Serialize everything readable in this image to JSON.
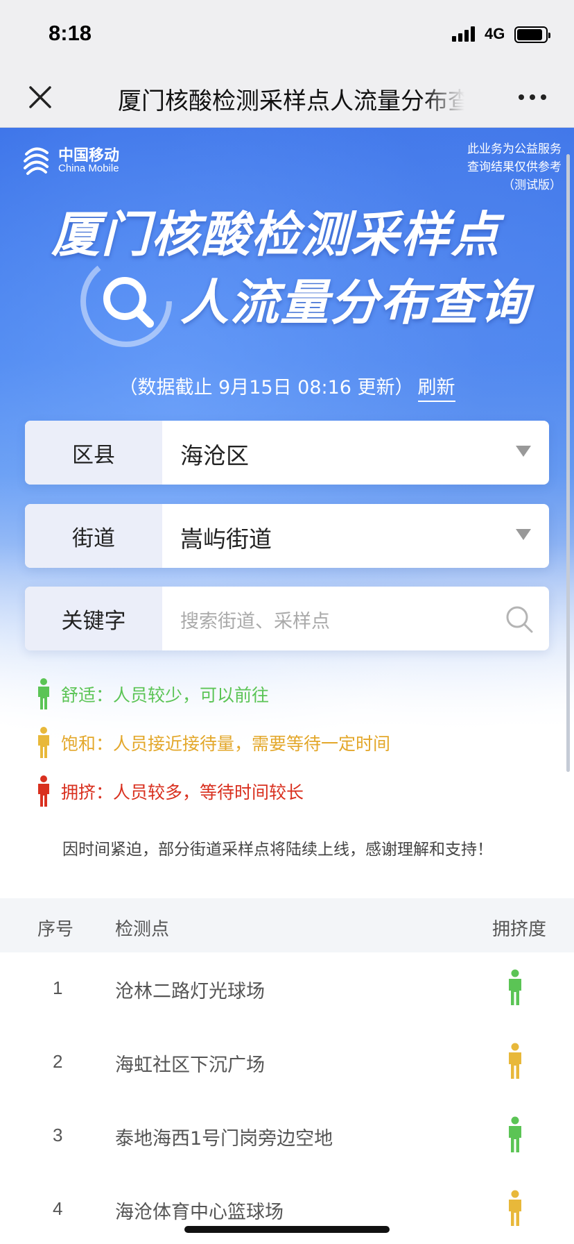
{
  "status": {
    "time": "8:18",
    "network": "4G"
  },
  "nav": {
    "title": "厦门核酸检测采样点人流量分布查询"
  },
  "hero": {
    "brand_cn": "中国移动",
    "brand_en": "China Mobile",
    "notice": [
      "此业务为公益服务",
      "查询结果仅供参考",
      "（测试版）"
    ],
    "title_line1": "厦门核酸检测采样点",
    "title_line2": "人流量分布查询",
    "update_text": "（数据截止 9月15日 08:16 更新）",
    "refresh_label": "刷新"
  },
  "filters": {
    "district": {
      "label": "区县",
      "value": "海沧区"
    },
    "street": {
      "label": "街道",
      "value": "嵩屿街道"
    },
    "keyword": {
      "label": "关键字",
      "placeholder": "搜索街道、采样点"
    }
  },
  "legend": {
    "comfort": {
      "text": "舒适：人员较少，可以前往",
      "color": "#5bc455"
    },
    "saturated": {
      "text": "饱和：人员接近接待量，需要等待一定时间",
      "color": "#e3a72a"
    },
    "crowded": {
      "text": "拥挤：人员较多，等待时间较长",
      "color": "#d9301f"
    }
  },
  "tip": "因时间紧迫，部分街道采样点将陆续上线，感谢理解和支持！",
  "table": {
    "headers": {
      "index": "序号",
      "site": "检测点",
      "crowd": "拥挤度"
    },
    "rows": [
      {
        "index": "1",
        "site": "沧林二路灯光球场",
        "level": "comfort"
      },
      {
        "index": "2",
        "site": "海虹社区下沉广场",
        "level": "saturated"
      },
      {
        "index": "3",
        "site": "泰地海西1号门岗旁边空地",
        "level": "comfort"
      },
      {
        "index": "4",
        "site": "海沧体育中心篮球场",
        "level": "saturated"
      }
    ]
  }
}
